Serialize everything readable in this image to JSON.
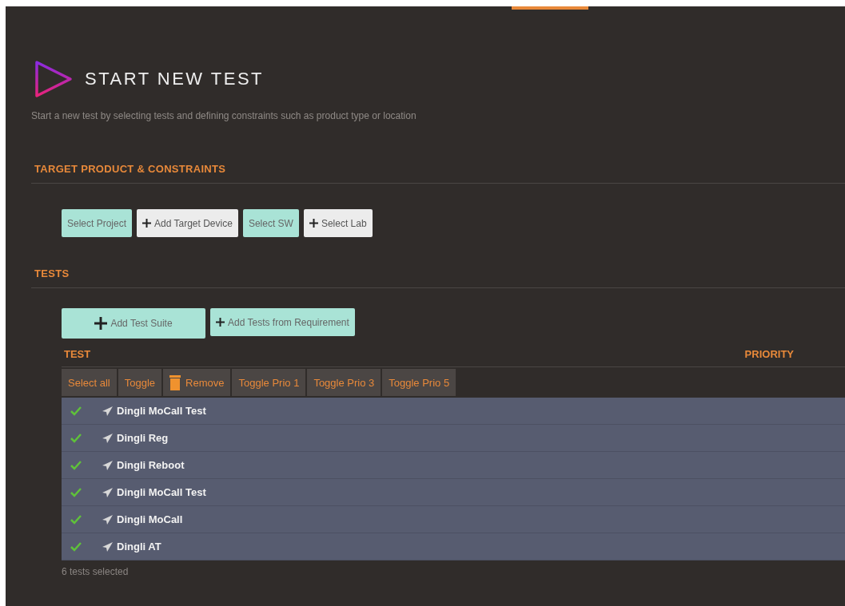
{
  "header": {
    "title": "START NEW TEST",
    "description": "Start a new test by selecting tests and defining constraints such as product type or location"
  },
  "constraints": {
    "heading": "TARGET PRODUCT & CONSTRAINTS",
    "buttons": [
      {
        "label": "Select Project",
        "kind": "primary",
        "plus": false
      },
      {
        "label": "Add Target Device",
        "kind": "secondary",
        "plus": true
      },
      {
        "label": "Select SW",
        "kind": "primary",
        "plus": false
      },
      {
        "label": "Select Lab",
        "kind": "secondary",
        "plus": true
      }
    ]
  },
  "tests": {
    "heading": "TESTS",
    "buttons": [
      {
        "label": "Add Test Suite",
        "kind": "large",
        "plus": true
      },
      {
        "label": "Add Tests from Requirement",
        "kind": "primary",
        "plus": true
      }
    ],
    "table": {
      "columns": [
        "TEST",
        "PRIORITY"
      ],
      "toolbar": [
        {
          "label": "Select all",
          "kind": "text"
        },
        {
          "label": "Toggle",
          "kind": "text"
        },
        {
          "label": "Remove",
          "kind": "trash"
        },
        {
          "label": "Toggle Prio 1",
          "kind": "text"
        },
        {
          "label": "Toggle Prio 3",
          "kind": "text"
        },
        {
          "label": "Toggle Prio 5",
          "kind": "text"
        }
      ],
      "rows": [
        {
          "name": "Dingli MoCall Test",
          "checked": true
        },
        {
          "name": "Dingli Reg",
          "checked": true
        },
        {
          "name": "Dingli Reboot",
          "checked": true
        },
        {
          "name": "Dingli MoCall Test",
          "checked": true
        },
        {
          "name": "Dingli MoCall",
          "checked": true
        },
        {
          "name": "Dingli AT",
          "checked": true
        }
      ]
    },
    "status": "6 tests selected"
  }
}
